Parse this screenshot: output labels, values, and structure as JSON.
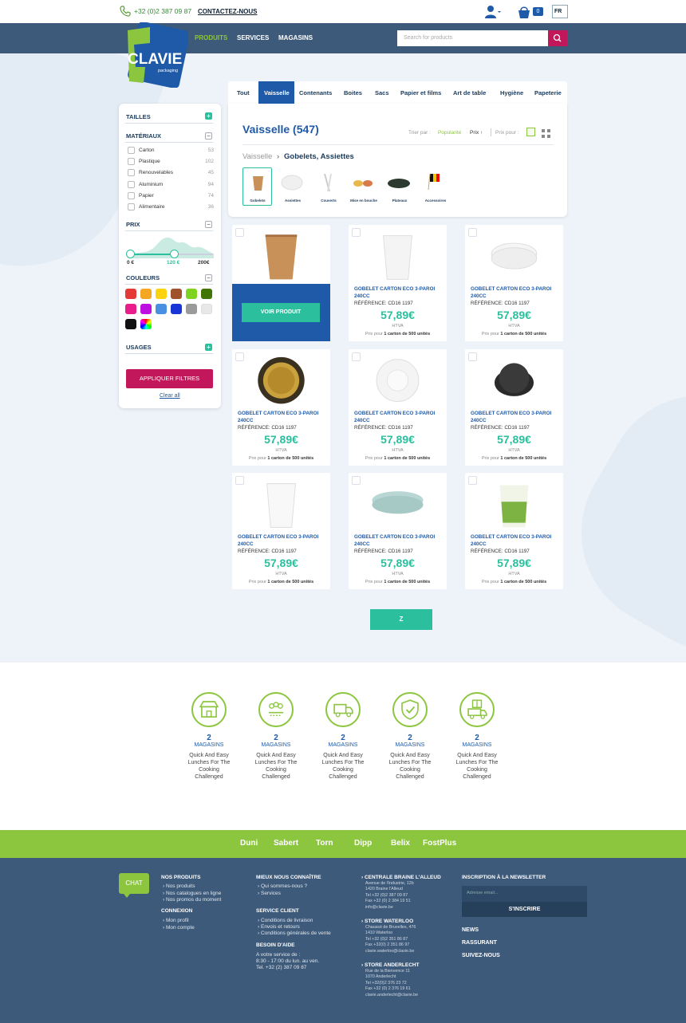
{
  "header": {
    "phone": "+32 (0)2 387 09 87",
    "contact": "CONTACTEZ-NOUS",
    "cart_count": "0",
    "lang": "FR"
  },
  "nav": {
    "items": [
      "PRODUITS",
      "SERVICES",
      "MAGASINS"
    ],
    "search_placeholder": "Search for products"
  },
  "logo": {
    "name": "CLAVIE",
    "sub": "packaging"
  },
  "sidebar": {
    "tailles": "TAILLES",
    "materiaux": "MATÉRIAUX",
    "materials": [
      {
        "label": "Carton",
        "count": "53"
      },
      {
        "label": "Plastique",
        "count": "102"
      },
      {
        "label": "Renouvelables",
        "count": "45"
      },
      {
        "label": "Aluminium",
        "count": "94"
      },
      {
        "label": "Papier",
        "count": "74"
      },
      {
        "label": "Alimentaire",
        "count": "36"
      }
    ],
    "prix": "PRIX",
    "price_min": "0 €",
    "price_mid": "120 €",
    "price_max": "200€",
    "price_selected_fraction": 0.6,
    "couleurs": "COULEURS",
    "colors": [
      "#e53935",
      "#f5a623",
      "#fbd20c",
      "#a0522d",
      "#7ed321",
      "#417505",
      "#e91e8c",
      "#bd10e0",
      "#4a90e2",
      "#1a35d6",
      "#9b9b9b",
      "#e8e8e8",
      "#111111",
      "rainbow"
    ],
    "usages": "USAGES",
    "apply": "APPLIQUER FILTRES",
    "clear": "Clear all"
  },
  "tabs": [
    "Tout",
    "Vaisselle",
    "Contenants",
    "Boites",
    "Sacs",
    "Papier et films",
    "Art de table",
    "Hygiène",
    "Papeterie"
  ],
  "main": {
    "title": "Vaisselle (547)",
    "sort_label": "Trier par :",
    "sort_pop": "Popularité",
    "sort_price": "Prix ↑",
    "price_label": "Prix pour :",
    "bc_root": "Vaisselle",
    "bc_sep": "›",
    "bc_current": "Gobelets, Assiettes",
    "categories": [
      "Gobelets",
      "Assiettes",
      "Couverts",
      "Mise en bouche",
      "Plateaux",
      "Accessoires"
    ]
  },
  "products": {
    "name": "GOBELET CARTON ECO 3-PAROI 240CC",
    "ref": "RÉFÉRENCE: CD16 1197",
    "price": "57,89€",
    "htva": "HTVA",
    "unit_pre": "Prix pour",
    "unit": "1 carton de 500 unités",
    "voir": "VOIR PRODUIT"
  },
  "load_more": "Z",
  "features": [
    {
      "num": "2",
      "label": "MAGASINS",
      "desc": "Quick And Easy Lunches For The Cooking Challenged",
      "icon": "store-icon"
    },
    {
      "num": "2",
      "label": "MAGASINS",
      "desc": "Quick And Easy Lunches For The Cooking Challenged",
      "icon": "rating-icon"
    },
    {
      "num": "2",
      "label": "MAGASINS",
      "desc": "Quick And Easy Lunches For The Cooking Challenged",
      "icon": "truck-icon"
    },
    {
      "num": "2",
      "label": "MAGASINS",
      "desc": "Quick And Easy Lunches For The Cooking Challenged",
      "icon": "shield-check-icon"
    },
    {
      "num": "2",
      "label": "MAGASINS",
      "desc": "Quick And Easy Lunches For The Cooking Challenged",
      "icon": "gift-truck-icon"
    }
  ],
  "brands": [
    "Duni",
    "Sabert",
    "Torn",
    "Dipp",
    "Belix",
    "FostPlus"
  ],
  "footer": {
    "chat": "CHAT",
    "nos_produits": "NOS PRODUITS",
    "np_links": [
      "Nos produits",
      "Nos catalogues en ligne",
      "Nos promos du moment"
    ],
    "connexion": "CONNEXION",
    "cx_links": [
      "Mon profil",
      "Mon compte"
    ],
    "mieux": "MIEUX NOUS CONNAÎTRE",
    "mieux_links": [
      "Qui sommes-nous ?",
      "Services"
    ],
    "service": "SERVICE CLIENT",
    "service_links": [
      "Conditions de livraison",
      "Envois et retours",
      "Conditions générales de vente"
    ],
    "besoin": "BESOIN D'AIDE",
    "besoin_lines": [
      "A votre service de :",
      "8:30 - 17:00 du lun. au ven.",
      "Tel. +32 (2) 387 09 87"
    ],
    "centrale": "CENTRALE BRAINE L'ALLEUD",
    "centrale_lines": [
      "Avenue de l'industrie, 12b",
      "1420 Braine l'Alleud",
      "Tel +32 (0)2 387 09 87",
      "Fax +32 (0) 2 384 19 51",
      "info@clavie.be"
    ],
    "waterloo": "STORE WATERLOO",
    "waterloo_lines": [
      "Chaussé de Bruxelles, 476",
      "1410 Waterloo",
      "Tel +32 (0)2 351 86 87",
      "Fax +32(0) 2 351 86 97",
      "clavie.waterloo@clavie.be"
    ],
    "anderlecht": "STORE ANDERLECHT",
    "anderlecht_lines": [
      "Rue de la Bienvence 11",
      "1070 Anderlecht",
      "Tel +32(0)2 376 23 72",
      "Fax +32 (0) 2 376 19 61",
      "clavie.anderlecht@clavie.be"
    ],
    "newsletter": "INSCRIPTION À LA NEWSLETTER",
    "email_placeholder": "Adresse email...",
    "subscribe": "S'INSCRIRE",
    "menu": [
      "NEWS",
      "RASSURANT",
      "SUIVEZ-NOUS"
    ]
  }
}
